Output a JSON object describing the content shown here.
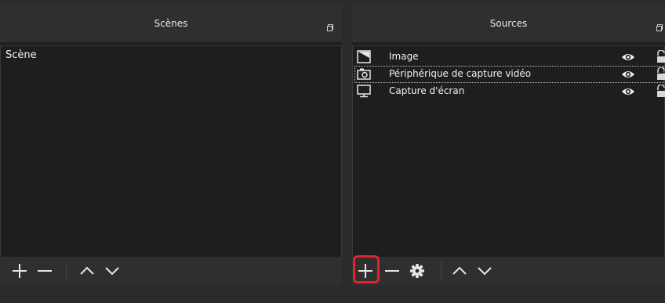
{
  "scenes": {
    "title": "Scènes",
    "items": [
      "Scène"
    ]
  },
  "sources": {
    "title": "Sources",
    "items": [
      {
        "label": "Image",
        "icon": "image-icon"
      },
      {
        "label": "Périphérique de capture vidéo",
        "icon": "camera-icon"
      },
      {
        "label": "Capture d'écran",
        "icon": "monitor-icon"
      }
    ]
  },
  "colors": {
    "highlight": "#e0242b",
    "panel": "#1e1e1e",
    "toolbar": "#2f2f2f"
  }
}
